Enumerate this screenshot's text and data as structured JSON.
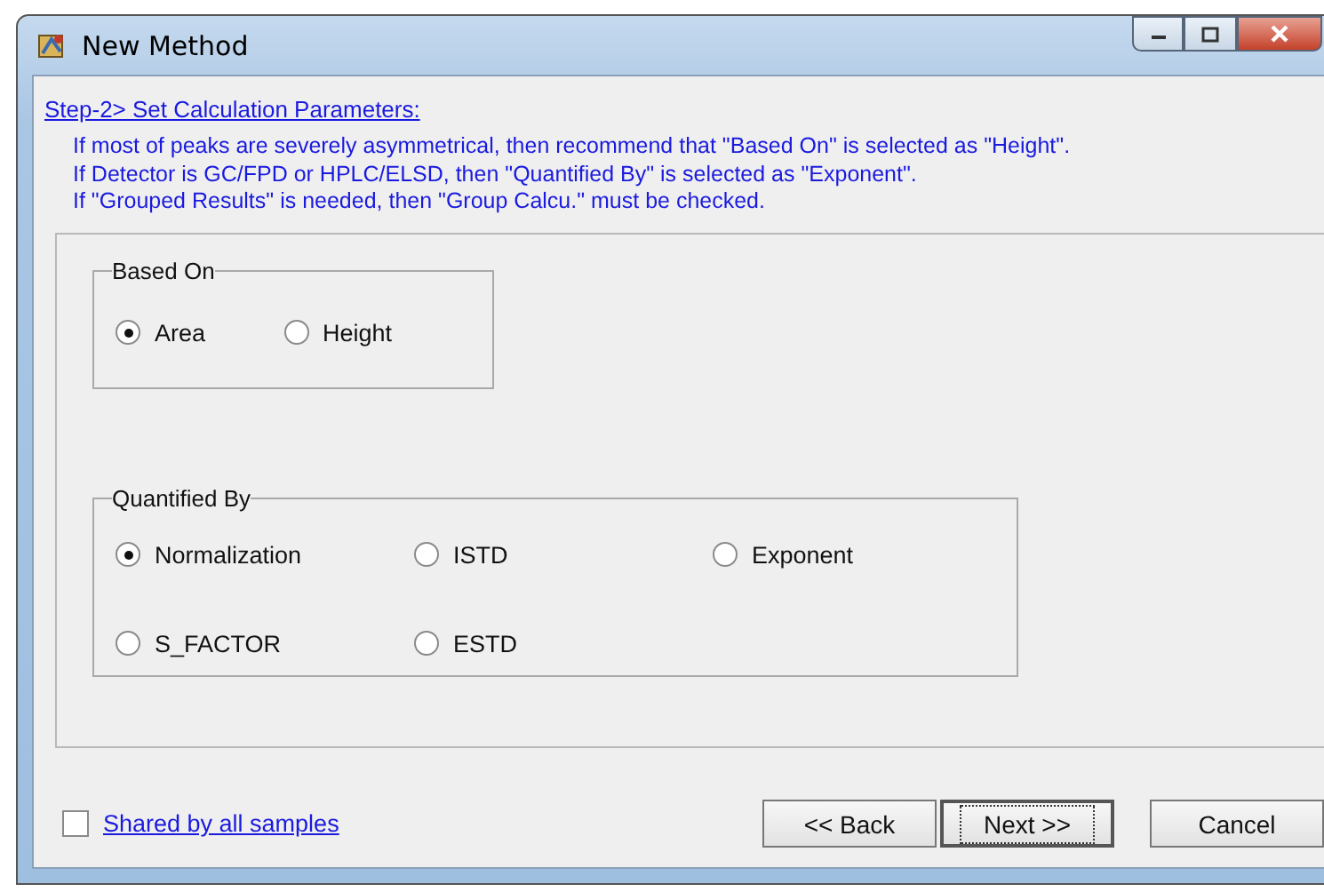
{
  "window": {
    "title": "New Method"
  },
  "step_link": "Step-2> Set Calculation Parameters:",
  "notes": [
    "If most of peaks are severely asymmetrical, then recommend that \"Based On\" is selected as \"Height\".",
    "If Detector is GC/FPD or HPLC/ELSD, then \"Quantified By\" is selected as \"Exponent\".",
    "If \"Grouped Results\" is needed, then \"Group Calcu.\" must be checked."
  ],
  "based_on": {
    "label": "Based On",
    "options": [
      {
        "label": "Area",
        "selected": true
      },
      {
        "label": "Height",
        "selected": false
      }
    ]
  },
  "quantified_by": {
    "label": "Quantified By",
    "options": [
      {
        "label": "Normalization",
        "selected": true
      },
      {
        "label": "ISTD",
        "selected": false
      },
      {
        "label": "Exponent",
        "selected": false
      },
      {
        "label": "S_FACTOR",
        "selected": false
      },
      {
        "label": "ESTD",
        "selected": false
      }
    ]
  },
  "shared": {
    "label": "Shared by all samples",
    "checked": false
  },
  "buttons": [
    {
      "label": "<< Back",
      "default": false
    },
    {
      "label": "Next >>",
      "default": true
    },
    {
      "label": "Cancel",
      "default": false
    }
  ]
}
